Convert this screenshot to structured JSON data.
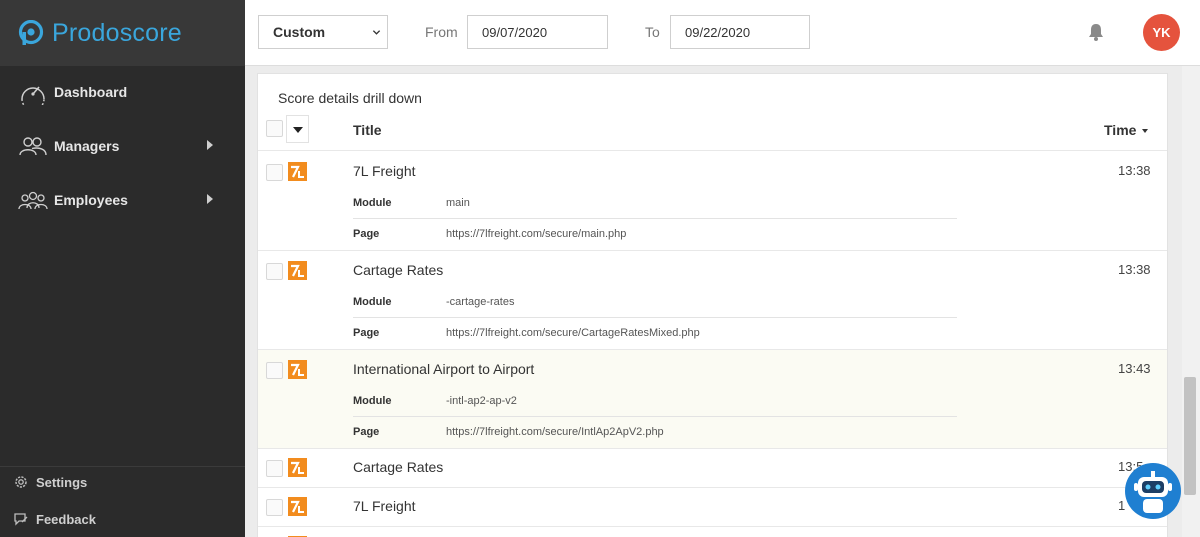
{
  "brand": {
    "name": "Prodoscore",
    "color": "#3aa6dc"
  },
  "sidebar": {
    "items": [
      {
        "label": "Dashboard",
        "icon": "gauge-icon"
      },
      {
        "label": "Managers",
        "icon": "managers-icon"
      },
      {
        "label": "Employees",
        "icon": "employees-icon"
      }
    ],
    "bottom": [
      {
        "label": "Settings",
        "icon": "gear-icon"
      },
      {
        "label": "Feedback",
        "icon": "feedback-icon"
      }
    ]
  },
  "topbar": {
    "range_select": "Custom",
    "from_label": "From",
    "from_date": "09/07/2020",
    "to_label": "To",
    "to_date": "09/22/2020",
    "avatar_initials": "YK",
    "avatar_color": "#e5533d"
  },
  "panel": {
    "title": "Score details drill down",
    "columns": {
      "title": "Title",
      "time": "Time"
    },
    "rows": [
      {
        "title": "7L Freight",
        "time": "13:38",
        "details": [
          {
            "key": "Module",
            "value": "main"
          },
          {
            "key": "Page",
            "value": "https://7lfreight.com/secure/main.php"
          }
        ]
      },
      {
        "title": "Cartage Rates",
        "time": "13:38",
        "details": [
          {
            "key": "Module",
            "value": "-cartage-rates"
          },
          {
            "key": "Page",
            "value": "https://7lfreight.com/secure/CartageRatesMixed.php"
          }
        ]
      },
      {
        "title": "International Airport to Airport",
        "time": "13:43",
        "highlighted": true,
        "details": [
          {
            "key": "Module",
            "value": "-intl-ap2-ap-v2"
          },
          {
            "key": "Page",
            "value": "https://7lfreight.com/secure/IntlAp2ApV2.php"
          }
        ]
      },
      {
        "title": "Cartage Rates",
        "time": "13:5"
      },
      {
        "title": "7L Freight",
        "time": "1"
      }
    ]
  },
  "colors": {
    "sidebar_bg": "#2b2b2b",
    "brand_bar_bg": "#383838",
    "app_icon": "#f28c1e",
    "highlight_row": "#fbfbf3",
    "bot": "#1f7fd1"
  }
}
